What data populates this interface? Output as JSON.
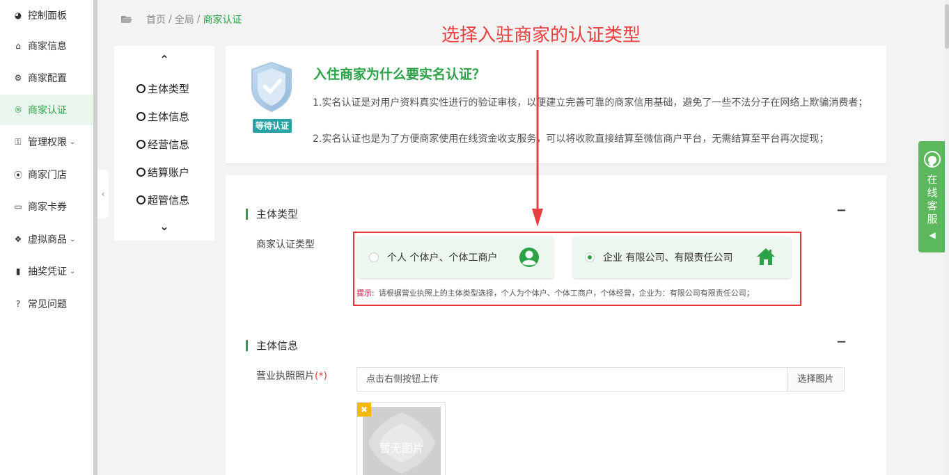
{
  "sidebar": {
    "items": [
      {
        "label": "控制面板",
        "icon": "dashboard-icon",
        "caret": ""
      },
      {
        "label": "商家信息",
        "icon": "home-icon",
        "caret": ""
      },
      {
        "label": "商家配置",
        "icon": "gears-icon",
        "caret": ""
      },
      {
        "label": "商家认证",
        "icon": "registered-icon",
        "caret": "",
        "active": true
      },
      {
        "label": "管理权限",
        "icon": "key-icon",
        "caret": "⌄"
      },
      {
        "label": "商家门店",
        "icon": "map-pin-icon",
        "caret": ""
      },
      {
        "label": "商家卡券",
        "icon": "card-icon",
        "caret": ""
      },
      {
        "label": "虚拟商品",
        "icon": "dropbox-icon",
        "caret": "⌄"
      },
      {
        "label": "抽奖凭证",
        "icon": "bookmark-icon",
        "caret": "⌄"
      },
      {
        "label": "常见问题",
        "icon": "question-icon",
        "caret": ""
      }
    ],
    "collapse_glyph": "‹"
  },
  "breadcrumb": {
    "home": "首页",
    "sep": "/",
    "global": "全局",
    "current": "商家认证"
  },
  "annotation": {
    "title": "选择入驻商家的认证类型"
  },
  "steps": {
    "up": "⌃",
    "down": "⌄",
    "items": [
      "主体类型",
      "主体信息",
      "经营信息",
      "结算账户",
      "超管信息"
    ]
  },
  "info": {
    "badge": "等待认证",
    "title": "入住商家为什么要实名认证？",
    "p1": "1.实名认证是对用户资料真实性进行的验证审核，以便建立完善可靠的商家信用基础，避免了一些不法分子在网络上欺骗消费者；",
    "p2": "2.实名认证也是为了方便商家使用在线资金收支服务，可以将收款直接结算至微信商户平台，无需结算至平台再次提现；"
  },
  "sections": {
    "type": {
      "title": "主体类型",
      "collapse": "−",
      "label": "商家认证类型",
      "options": [
        {
          "label": "个人 个体户、个体工商户",
          "selected": false,
          "icon": "user-circle-icon"
        },
        {
          "label": "企业 有限公司、有限责任公司",
          "selected": true,
          "icon": "house-icon"
        }
      ],
      "hint_label": "提示:",
      "hint": "请根据营业执照上的主体类型选择，个人为个体户、个体工商户，个体经营，企业为：有限公司有限责任公司；"
    },
    "subject": {
      "title": "主体信息",
      "collapse": "−",
      "license_label": "营业执照照片",
      "required_mark": "(*)",
      "upload_placeholder": "点击右侧按钮上传",
      "upload_button": "选择图片",
      "no_image": "暂无图片",
      "delete_glyph": "✖"
    }
  },
  "service": {
    "text": "在线客服",
    "tri": "◀"
  },
  "colors": {
    "accent": "#2ba245",
    "annotation": "#e84040",
    "badge": "#2aa2a8",
    "service": "#5cb85c"
  }
}
